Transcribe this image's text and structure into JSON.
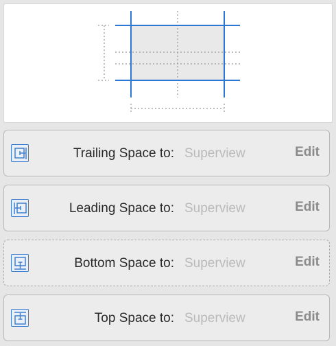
{
  "preview": {
    "accent_color": "#2b78d4",
    "guide_color": "#a8a8a8",
    "box_fill": "#e9e9e9"
  },
  "constraints": [
    {
      "label": "Trailing Space to:",
      "value": "Superview",
      "action": "Edit",
      "icon": "trailing-space-icon",
      "style": "solid"
    },
    {
      "label": "Leading Space to:",
      "value": "Superview",
      "action": "Edit",
      "icon": "leading-space-icon",
      "style": "solid"
    },
    {
      "label": "Bottom Space to:",
      "value": "Superview",
      "action": "Edit",
      "icon": "bottom-space-icon",
      "style": "dashed"
    },
    {
      "label": "Top Space to:",
      "value": "Superview",
      "action": "Edit",
      "icon": "top-space-icon",
      "style": "solid"
    }
  ]
}
